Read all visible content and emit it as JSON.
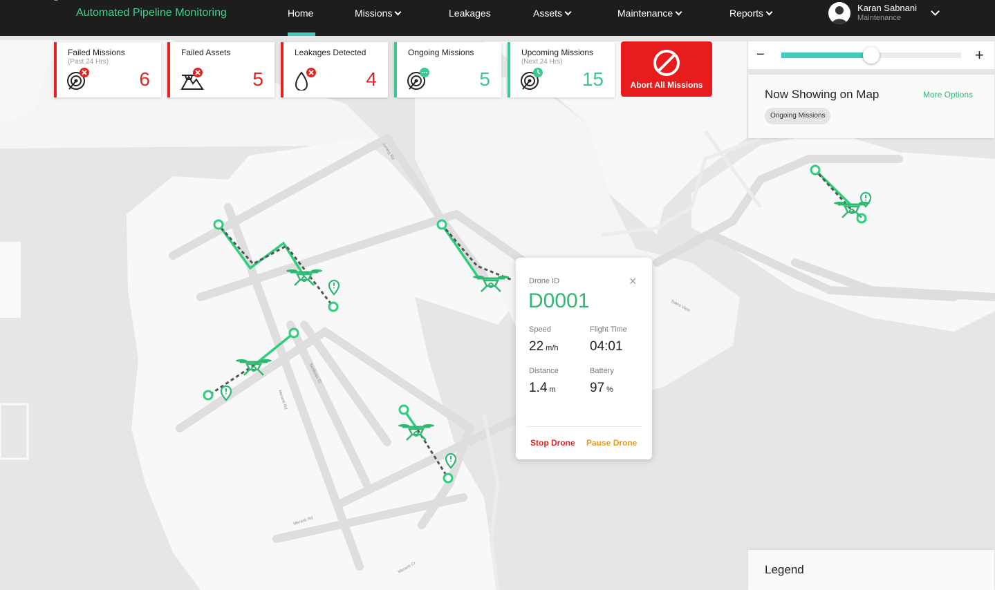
{
  "header": {
    "app_title": "Automated Pipeline Monitoring",
    "nav": [
      {
        "label": "Home",
        "dropdown": false
      },
      {
        "label": "Missions",
        "dropdown": true
      },
      {
        "label": "Leakages",
        "dropdown": false
      },
      {
        "label": "Assets",
        "dropdown": true
      },
      {
        "label": "Maintenance",
        "dropdown": true
      },
      {
        "label": "Reports",
        "dropdown": true
      }
    ],
    "active_nav": "Home",
    "user": {
      "name": "Karan Sabnani",
      "role": "Maintenance"
    }
  },
  "stats": [
    {
      "title": "Failed Missions",
      "subtitle": "(Past 24 Hrs)",
      "value": "6",
      "status": "red",
      "icon": "failed-missions-icon"
    },
    {
      "title": "Failed Assets",
      "subtitle": "",
      "value": "5",
      "status": "red",
      "icon": "failed-assets-icon"
    },
    {
      "title": "Leakages Detected",
      "subtitle": "",
      "value": "4",
      "status": "red",
      "icon": "leakage-icon"
    },
    {
      "title": "Ongoing Missions",
      "subtitle": "",
      "value": "5",
      "status": "green",
      "icon": "ongoing-missions-icon"
    },
    {
      "title": "Upcoming Missions",
      "subtitle": "(Next 24 Hrs)",
      "value": "15",
      "status": "green",
      "icon": "upcoming-missions-icon"
    }
  ],
  "abort": {
    "label": "Abort All Missions",
    "icon": "no-entry-icon"
  },
  "zoom": {
    "minus": "−",
    "plus": "+",
    "level": 0.5
  },
  "now_showing": {
    "title": "Now Showing on Map",
    "more": "More Options",
    "chip": "Ongoing Missions"
  },
  "popup": {
    "id_label": "Drone ID",
    "drone_id": "D0001",
    "close": "×",
    "speed_label": "Speed",
    "speed_value": "22",
    "speed_unit": "m/h",
    "flight_time_label": "Flight Time",
    "flight_time_value": "04:01",
    "distance_label": "Distance",
    "distance_value": "1.4",
    "distance_unit": "m",
    "battery_label": "Battery",
    "battery_value": "97",
    "battery_unit": "%",
    "stop": "Stop Drone",
    "pause": "Pause Drone"
  },
  "legend": {
    "title": "Legend"
  },
  "map": {
    "street_labels": [
      "Jurong Rd",
      "Tembusu Cr",
      "Meranti Rd",
      "Meranti Rd",
      "Meranti Cr",
      "Sakra View"
    ]
  },
  "colors": {
    "accent": "#3cc98f",
    "danger": "#e32424",
    "warning": "#f19a12",
    "nav_bg": "#1d1d1d",
    "teal": "#3ecdbd"
  }
}
